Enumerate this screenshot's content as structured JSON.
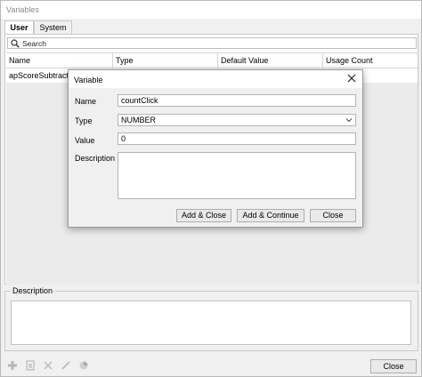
{
  "window": {
    "title": "Variables"
  },
  "tabs": [
    {
      "label": "User"
    },
    {
      "label": "System"
    }
  ],
  "search": {
    "value": "Search"
  },
  "table": {
    "columns": [
      "Name",
      "Type",
      "Default Value",
      "Usage Count"
    ],
    "rows": [
      {
        "name": "apScoreSubtract"
      }
    ]
  },
  "description_group": {
    "legend": "Description"
  },
  "toolbar": {
    "icons": [
      "add-icon",
      "copy-icon",
      "delete-icon",
      "edit-icon",
      "chart-icon"
    ],
    "close_label": "Close"
  },
  "dialog": {
    "title": "Variable",
    "name_label": "Name",
    "name_value": "countClick",
    "type_label": "Type",
    "type_value": "NUMBER",
    "value_label": "Value",
    "value_value": "0",
    "description_label": "Description",
    "description_value": "",
    "buttons": [
      "Add & Close",
      "Add & Continue",
      "Close"
    ]
  }
}
